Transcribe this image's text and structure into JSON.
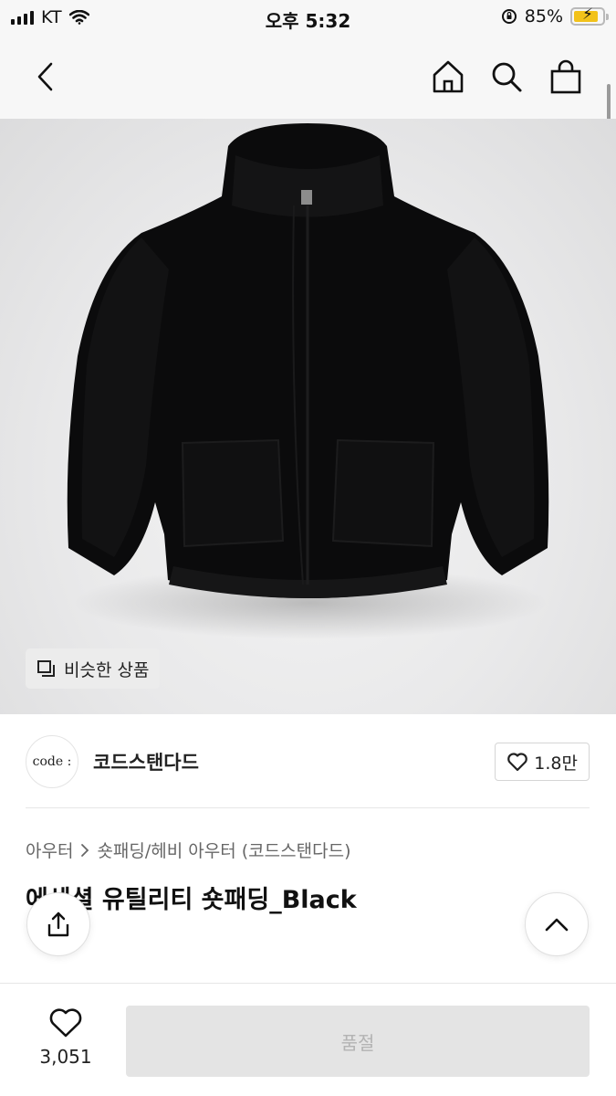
{
  "status_bar": {
    "carrier": "KT",
    "time": "오후 5:32",
    "battery_percent": "85%",
    "battery_level": 0.85,
    "battery_color": "#f2c21a"
  },
  "nav": {
    "icons": [
      "back-chevron-icon",
      "home-icon",
      "search-icon",
      "shopping-bag-icon"
    ]
  },
  "product_image": {
    "similar_products_label": "비슷한 상품",
    "icon": "similar-items-icon"
  },
  "shop": {
    "logo_text": "code :",
    "name": "코드스탠다드",
    "likes": "1.8만",
    "icon": "heart-outline-icon"
  },
  "breadcrumb": {
    "category": "아우터",
    "separator_icon": "chevron-right-icon",
    "subcategory": "숏패딩/헤비 아우터 (코드스탠다드)"
  },
  "product": {
    "title": "에센셜 유틸리티 숏패딩_Black"
  },
  "floating_buttons": {
    "share_icon": "share-icon",
    "scroll_top_icon": "chevron-up-icon"
  },
  "bottom_bar": {
    "like_count": "3,051",
    "buy_label": "품절",
    "buy_disabled_color": "#e4e4e4"
  }
}
